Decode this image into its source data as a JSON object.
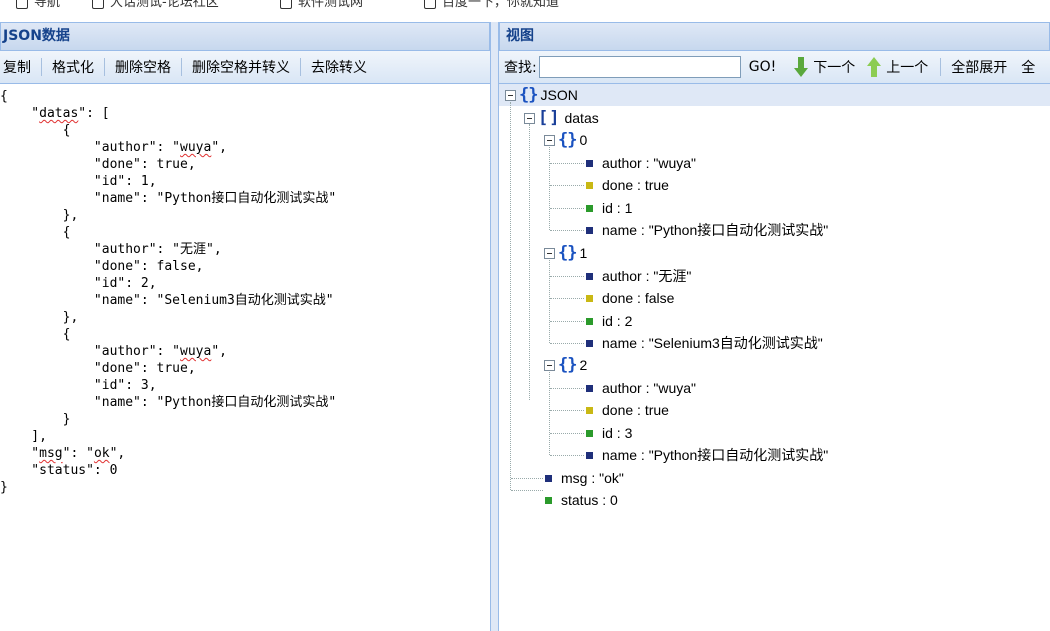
{
  "bookmarks": [
    {
      "label": "导航"
    },
    {
      "label": "大话测试-论坛社区"
    },
    {
      "label": "软件测试网"
    },
    {
      "label": "百度一下，你就知道"
    }
  ],
  "left_panel": {
    "title": "JSON数据",
    "toolbar": [
      "复制",
      "格式化",
      "删除空格",
      "删除空格并转义",
      "去除转义"
    ],
    "code_lines": [
      "{",
      "    \"datas\": [",
      "        {",
      "            \"author\": \"wuya\",",
      "            \"done\": true,",
      "            \"id\": 1,",
      "            \"name\": \"Python接口自动化测试实战\"",
      "        },",
      "        {",
      "            \"author\": \"无涯\",",
      "            \"done\": false,",
      "            \"id\": 2,",
      "            \"name\": \"Selenium3自动化测试实战\"",
      "        },",
      "        {",
      "            \"author\": \"wuya\",",
      "            \"done\": true,",
      "            \"id\": 3,",
      "            \"name\": \"Python接口自动化测试实战\"",
      "        }",
      "    ],",
      "    \"msg\": \"ok\",",
      "    \"status\": 0",
      "}"
    ]
  },
  "right_panel": {
    "title": "视图",
    "search_label": "查找:",
    "search_value": "",
    "go_label": "GO!",
    "next_label": "下一个",
    "prev_label": "上一个",
    "expand_all_label": "全部展开",
    "collapse_all_label": "全"
  },
  "tree": {
    "root_label": "JSON",
    "datas_label": "datas",
    "items": [
      {
        "index": "0",
        "fields": [
          {
            "text": "author : \"wuya\"",
            "kind": "string"
          },
          {
            "text": "done : true",
            "kind": "boolean"
          },
          {
            "text": "id : 1",
            "kind": "number"
          },
          {
            "text": "name : \"Python接口自动化测试实战\"",
            "kind": "string"
          }
        ]
      },
      {
        "index": "1",
        "fields": [
          {
            "text": "author : \"无涯\"",
            "kind": "string"
          },
          {
            "text": "done : false",
            "kind": "boolean"
          },
          {
            "text": "id : 2",
            "kind": "number"
          },
          {
            "text": "name : \"Selenium3自动化测试实战\"",
            "kind": "string"
          }
        ]
      },
      {
        "index": "2",
        "fields": [
          {
            "text": "author : \"wuya\"",
            "kind": "string"
          },
          {
            "text": "done : true",
            "kind": "boolean"
          },
          {
            "text": "id : 3",
            "kind": "number"
          },
          {
            "text": "name : \"Python接口自动化测试实战\"",
            "kind": "string"
          }
        ]
      }
    ],
    "msg": {
      "text": "msg : \"ok\"",
      "kind": "string"
    },
    "status": {
      "text": "status : 0",
      "kind": "number"
    }
  },
  "colors": {
    "string": "#1f2f7a",
    "boolean": "#c9b814",
    "number": "#2b9a2b",
    "header_text": "#15428b",
    "squiggle": "#e03030"
  }
}
